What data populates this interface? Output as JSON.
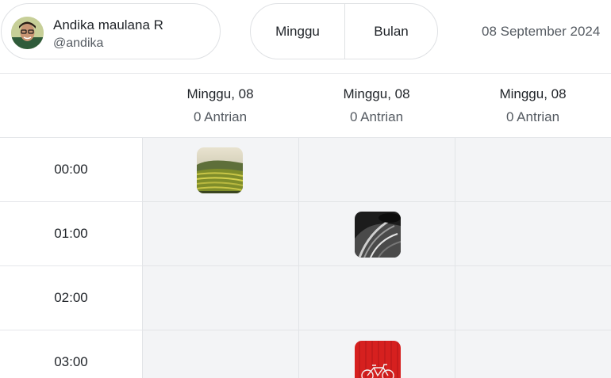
{
  "user": {
    "name": "Andika maulana R",
    "handle": "@andika"
  },
  "view_toggle": {
    "week_label": "Minggu",
    "month_label": "Bulan"
  },
  "current_date": "08 September 2024",
  "columns": [
    {
      "day": "Minggu, 08",
      "queue": "0 Antrian"
    },
    {
      "day": "Minggu, 08",
      "queue": "0 Antrian"
    },
    {
      "day": "Minggu, 08",
      "queue": "0 Antrian"
    }
  ],
  "times": [
    "00:00",
    "01:00",
    "02:00",
    "03:00"
  ],
  "events": [
    {
      "time": "00:00",
      "column": 1,
      "image": "rice-terrace-photo"
    },
    {
      "time": "01:00",
      "column": 2,
      "image": "monochrome-fabric-photo"
    },
    {
      "time": "03:00",
      "column": 2,
      "image": "red-bicycle-photo"
    }
  ]
}
